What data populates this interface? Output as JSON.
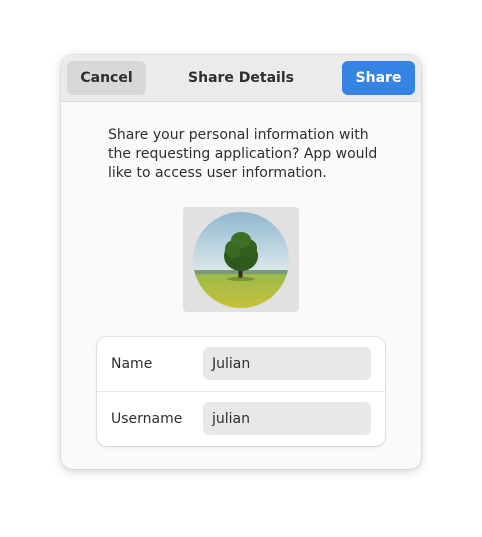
{
  "dialog": {
    "title": "Share Details",
    "cancel_label": "Cancel",
    "share_label": "Share",
    "message": "Share your personal information with the requesting application? App would like to access user information."
  },
  "avatar": {
    "icon": "tree-landscape-avatar"
  },
  "fields": [
    {
      "label": "Name",
      "value": "Julian"
    },
    {
      "label": "Username",
      "value": "julian"
    }
  ],
  "colors": {
    "accent": "#3584e4",
    "header_bg": "#ebebeb",
    "dialog_bg": "#fafafa"
  }
}
